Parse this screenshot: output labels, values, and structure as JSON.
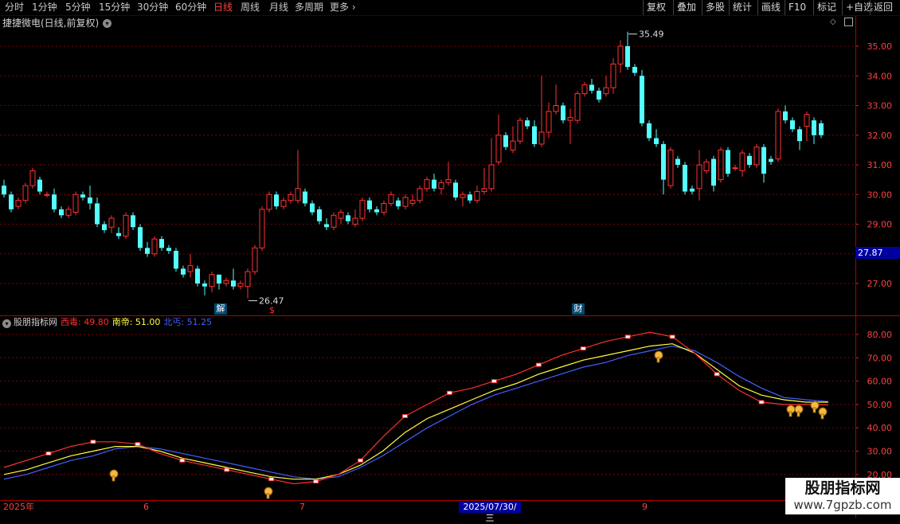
{
  "toolbar": {
    "periods": [
      "分时",
      "1分钟",
      "5分钟",
      "15分钟",
      "30分钟",
      "60分钟",
      "日线",
      "周线",
      "月线",
      "多周期",
      "更多"
    ],
    "active_period": "日线",
    "right_buttons": [
      "复权",
      "叠加",
      "多股",
      "统计",
      "画线",
      "F10",
      "标记",
      "+自选",
      "返回"
    ]
  },
  "header": {
    "stock_title": "捷捷微电(日线,前复权)"
  },
  "main_chart": {
    "y_axis_labels": [
      "35.00",
      "34.00",
      "33.00",
      "32.00",
      "31.00",
      "30.00",
      "29.00",
      "28.00",
      "27.00"
    ],
    "high_label": "35.49",
    "low_label": "26.47",
    "current_price": "27.87",
    "badges": {
      "jie": "解",
      "cai": "财",
      "dollar": "$"
    },
    "colors": {
      "up": "#ff3232",
      "down": "#54ffff",
      "grid": "#7a0000"
    }
  },
  "indicator": {
    "name": "股朋指标网",
    "lines": [
      {
        "label": "西毒: 49.80",
        "color": "#ff3030"
      },
      {
        "label": "南帝: 51.00",
        "color": "#ffff40"
      },
      {
        "label": "北丐: 51.25",
        "color": "#4060ff"
      }
    ],
    "y_axis_labels": [
      "80.00",
      "70.00",
      "60.00",
      "50.00",
      "40.00",
      "30.00",
      "20.00"
    ]
  },
  "x_axis": {
    "labels": [
      "2025年",
      "6",
      "7",
      "9"
    ],
    "highlight": "2025/07/30/三"
  },
  "watermark": {
    "title": "股朋指标网",
    "url": "www.7gpzb.com"
  },
  "chart_data": {
    "type": "candlestick",
    "candles": [
      [
        30.3,
        30.5,
        29.9,
        30.0
      ],
      [
        30.0,
        30.1,
        29.4,
        29.5
      ],
      [
        29.6,
        29.9,
        29.5,
        29.8
      ],
      [
        29.8,
        30.4,
        29.7,
        30.3
      ],
      [
        30.3,
        30.9,
        30.2,
        30.8
      ],
      [
        30.5,
        30.6,
        30.0,
        30.1
      ],
      [
        30.0,
        30.1,
        29.9,
        30.0
      ],
      [
        30.0,
        30.2,
        29.4,
        29.5
      ],
      [
        29.5,
        29.6,
        29.2,
        29.3
      ],
      [
        29.3,
        29.6,
        29.2,
        29.5
      ],
      [
        29.4,
        30.1,
        29.3,
        30.0
      ],
      [
        30.0,
        30.1,
        29.8,
        29.9
      ],
      [
        29.9,
        30.3,
        29.5,
        29.7
      ],
      [
        29.7,
        29.9,
        28.9,
        29.0
      ],
      [
        29.0,
        29.1,
        28.7,
        28.8
      ],
      [
        28.9,
        29.3,
        28.7,
        29.2
      ],
      [
        28.7,
        28.9,
        28.5,
        28.6
      ],
      [
        28.6,
        29.4,
        28.5,
        29.3
      ],
      [
        29.3,
        29.4,
        28.8,
        28.9
      ],
      [
        28.9,
        29.0,
        28.1,
        28.2
      ],
      [
        28.2,
        28.4,
        27.9,
        28.0
      ],
      [
        28.0,
        28.6,
        27.9,
        28.5
      ],
      [
        28.5,
        28.6,
        28.1,
        28.2
      ],
      [
        28.2,
        28.3,
        28.0,
        28.1
      ],
      [
        28.1,
        28.2,
        27.4,
        27.5
      ],
      [
        27.5,
        27.6,
        27.2,
        27.3
      ],
      [
        27.4,
        28.0,
        27.2,
        27.6
      ],
      [
        27.5,
        27.6,
        26.9,
        27.0
      ],
      [
        27.0,
        27.1,
        26.6,
        26.9
      ],
      [
        26.9,
        27.4,
        26.7,
        27.3
      ],
      [
        27.3,
        27.3,
        26.8,
        27.0
      ],
      [
        27.0,
        27.2,
        26.9,
        27.1
      ],
      [
        27.1,
        27.5,
        26.8,
        26.9
      ],
      [
        26.9,
        27.1,
        26.8,
        27.0
      ],
      [
        26.9,
        27.5,
        26.5,
        27.4
      ],
      [
        27.4,
        28.3,
        27.3,
        28.2
      ],
      [
        28.2,
        29.6,
        28.1,
        29.5
      ],
      [
        29.5,
        30.1,
        29.4,
        30.0
      ],
      [
        30.0,
        30.1,
        29.5,
        29.6
      ],
      [
        29.6,
        29.9,
        29.5,
        29.8
      ],
      [
        29.8,
        30.1,
        29.7,
        30.0
      ],
      [
        29.8,
        31.5,
        29.7,
        30.2
      ],
      [
        30.1,
        30.2,
        29.6,
        29.7
      ],
      [
        29.7,
        29.8,
        29.3,
        29.4
      ],
      [
        29.5,
        29.6,
        29.0,
        29.1
      ],
      [
        29.0,
        29.2,
        28.8,
        28.9
      ],
      [
        28.9,
        29.4,
        28.8,
        29.3
      ],
      [
        29.2,
        29.5,
        29.0,
        29.4
      ],
      [
        29.3,
        29.4,
        29.0,
        29.1
      ],
      [
        29.0,
        29.5,
        28.9,
        29.2
      ],
      [
        29.2,
        29.9,
        29.1,
        29.8
      ],
      [
        29.8,
        29.9,
        29.4,
        29.5
      ],
      [
        29.5,
        29.6,
        29.3,
        29.4
      ],
      [
        29.4,
        29.8,
        29.3,
        29.7
      ],
      [
        29.7,
        30.1,
        29.6,
        30.0
      ],
      [
        29.8,
        29.9,
        29.5,
        29.6
      ],
      [
        29.6,
        30.0,
        29.5,
        29.9
      ],
      [
        29.7,
        30.0,
        29.6,
        29.8
      ],
      [
        29.8,
        30.3,
        29.7,
        30.2
      ],
      [
        30.2,
        30.6,
        30.1,
        30.5
      ],
      [
        30.5,
        30.7,
        30.1,
        30.2
      ],
      [
        30.2,
        30.5,
        30.0,
        30.4
      ],
      [
        30.4,
        31.1,
        30.3,
        30.5
      ],
      [
        30.4,
        30.5,
        29.8,
        29.9
      ],
      [
        29.9,
        30.1,
        29.6,
        30.0
      ],
      [
        30.0,
        30.1,
        29.7,
        29.8
      ],
      [
        29.8,
        30.3,
        29.7,
        30.1
      ],
      [
        30.1,
        30.9,
        30.0,
        30.2
      ],
      [
        30.2,
        31.9,
        30.1,
        31.0
      ],
      [
        31.1,
        32.7,
        31.0,
        32.0
      ],
      [
        32.0,
        32.1,
        31.5,
        31.6
      ],
      [
        31.5,
        32.3,
        31.4,
        31.8
      ],
      [
        31.8,
        32.6,
        31.7,
        32.5
      ],
      [
        32.5,
        32.6,
        32.2,
        32.3
      ],
      [
        32.3,
        32.5,
        31.6,
        31.7
      ],
      [
        31.7,
        34.0,
        31.6,
        32.1
      ],
      [
        32.1,
        33.1,
        31.9,
        32.8
      ],
      [
        32.8,
        33.7,
        32.7,
        33.0
      ],
      [
        33.0,
        33.1,
        32.4,
        32.5
      ],
      [
        32.5,
        32.9,
        31.7,
        32.6
      ],
      [
        32.5,
        33.5,
        32.4,
        33.4
      ],
      [
        33.4,
        33.8,
        33.3,
        33.7
      ],
      [
        33.7,
        33.9,
        33.4,
        33.5
      ],
      [
        33.5,
        33.6,
        33.1,
        33.2
      ],
      [
        33.4,
        34.0,
        33.3,
        33.6
      ],
      [
        33.6,
        34.6,
        33.4,
        34.4
      ],
      [
        34.4,
        35.2,
        34.1,
        35.0
      ],
      [
        35.0,
        35.49,
        34.2,
        34.3
      ],
      [
        34.3,
        34.4,
        34.0,
        34.1
      ],
      [
        34.0,
        34.2,
        32.3,
        32.4
      ],
      [
        32.4,
        32.5,
        31.8,
        31.9
      ],
      [
        31.9,
        32.2,
        31.6,
        31.7
      ],
      [
        31.7,
        31.8,
        30.0,
        30.5
      ],
      [
        30.3,
        31.6,
        30.2,
        31.5
      ],
      [
        31.2,
        31.3,
        30.9,
        31.0
      ],
      [
        31.0,
        31.1,
        30.0,
        30.1
      ],
      [
        30.2,
        30.3,
        30.0,
        30.1
      ],
      [
        30.2,
        31.5,
        29.8,
        31.0
      ],
      [
        30.8,
        31.2,
        30.7,
        31.1
      ],
      [
        31.2,
        31.3,
        30.1,
        30.3
      ],
      [
        30.5,
        31.6,
        30.4,
        31.5
      ],
      [
        31.5,
        31.6,
        30.6,
        30.7
      ],
      [
        30.9,
        31.0,
        30.8,
        30.9
      ],
      [
        30.8,
        31.5,
        30.6,
        31.4
      ],
      [
        31.3,
        31.4,
        30.9,
        31.0
      ],
      [
        31.0,
        31.7,
        30.9,
        31.6
      ],
      [
        31.6,
        31.7,
        30.4,
        30.7
      ],
      [
        31.2,
        31.3,
        31.0,
        31.1
      ],
      [
        31.2,
        32.9,
        31.1,
        32.8
      ],
      [
        32.8,
        33.0,
        32.4,
        32.5
      ],
      [
        32.5,
        32.6,
        32.1,
        32.2
      ],
      [
        32.2,
        32.3,
        31.5,
        31.8
      ],
      [
        32.3,
        32.8,
        31.8,
        32.7
      ],
      [
        32.5,
        32.6,
        31.7,
        32.0
      ],
      [
        32.4,
        32.5,
        31.9,
        32.0
      ]
    ],
    "indicator_series": [
      {
        "name": "西毒",
        "values": [
          23,
          26,
          29,
          32,
          34,
          34,
          33,
          29,
          26,
          24,
          22,
          20,
          18,
          16,
          17,
          20,
          26,
          36,
          45,
          50,
          55,
          57,
          60,
          63,
          67,
          71,
          74,
          77,
          79,
          81,
          79,
          72,
          63,
          56,
          51,
          50,
          50,
          49.8
        ]
      },
      {
        "name": "南帝",
        "values": [
          20,
          22,
          25,
          28,
          30,
          32,
          32,
          30,
          27,
          25,
          23,
          21,
          19,
          18,
          18,
          20,
          24,
          30,
          38,
          44,
          48,
          52,
          56,
          59,
          63,
          66,
          69,
          71,
          73,
          75,
          76,
          72,
          65,
          58,
          54,
          52,
          51,
          51.0
        ]
      },
      {
        "name": "北丐",
        "values": [
          18,
          20,
          23,
          26,
          28,
          31,
          32,
          31,
          29,
          27,
          25,
          23,
          21,
          19,
          18,
          19,
          23,
          28,
          34,
          40,
          45,
          50,
          54,
          57,
          60,
          63,
          66,
          68,
          71,
          73,
          75,
          73,
          68,
          62,
          57,
          53,
          52,
          51.25
        ]
      }
    ],
    "indicator_ylim": [
      15,
      85
    ]
  }
}
